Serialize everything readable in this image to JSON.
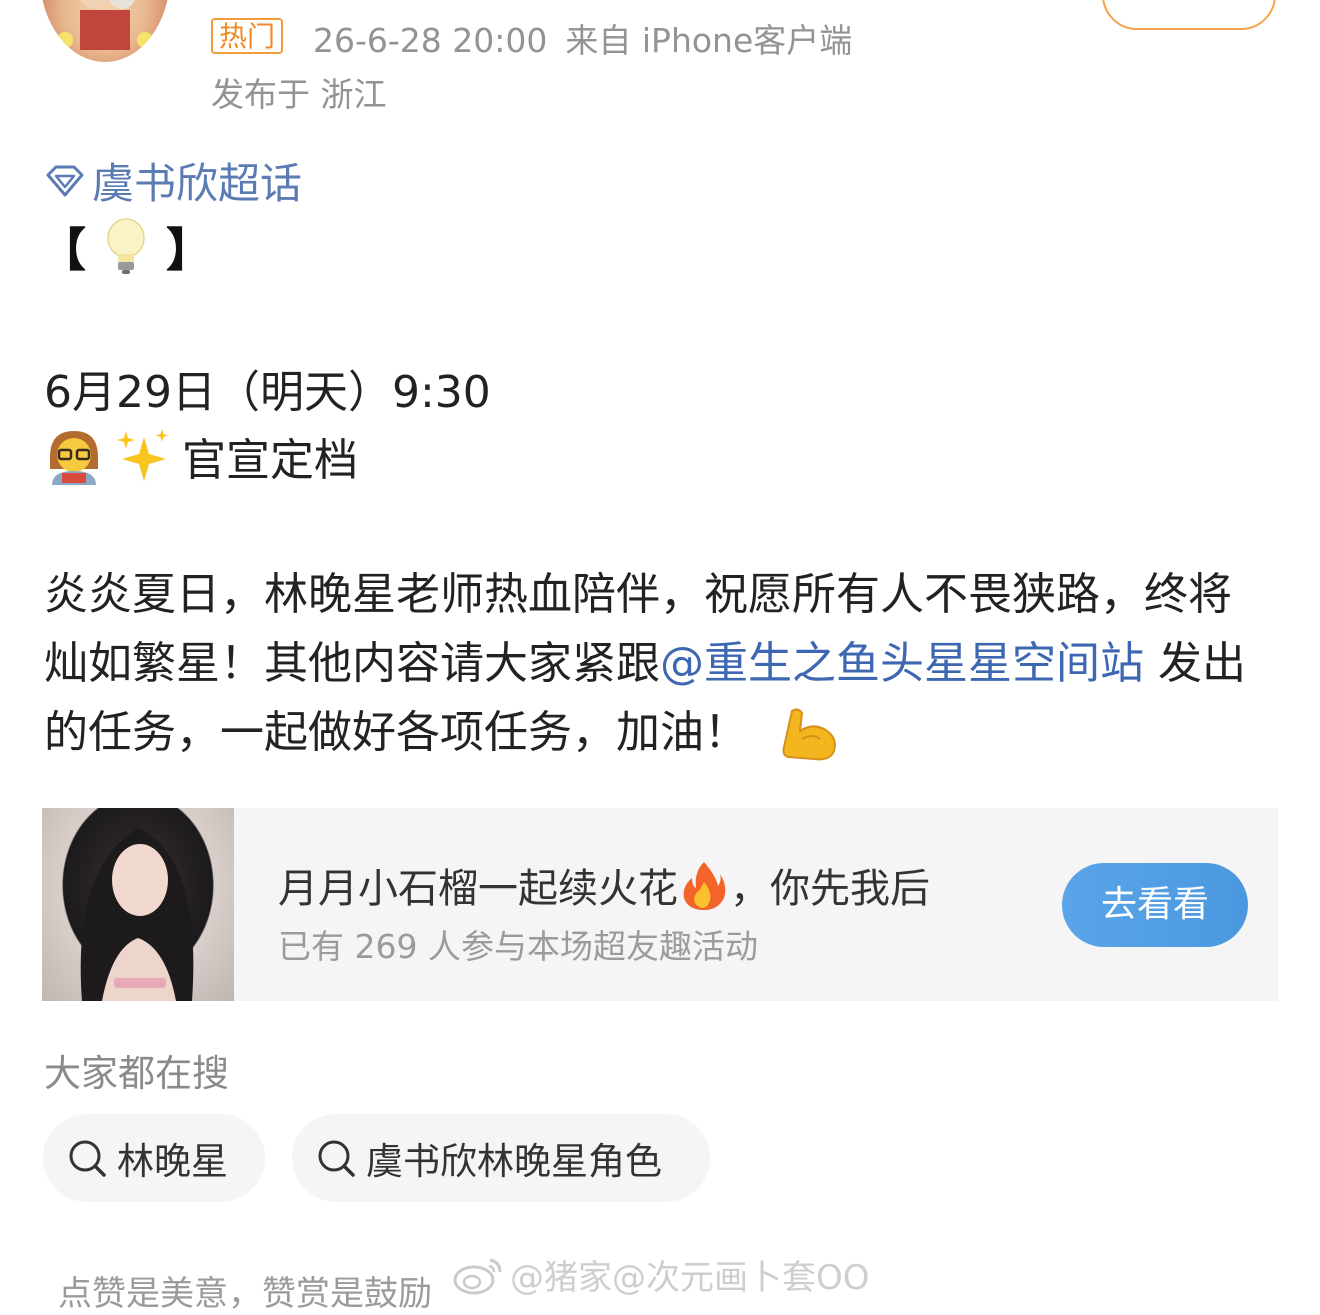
{
  "header": {
    "hot_badge": "热门",
    "timestamp": "26-6-28 20:00",
    "source": "来自 iPhone客户端",
    "location": "发布于 浙江"
  },
  "post": {
    "topic": "虞书欣超话",
    "bracket_open": "【",
    "bracket_close": "】",
    "date_line": "6月29日（明天）9:30",
    "official_line": "官宣定档",
    "para_text_1": "炎炎夏日，林晚星老师热血陪伴，祝愿所有人不畏狭路，终将灿如繁星！其他内容请大家紧跟",
    "mention": "@重生之鱼头星星空间站",
    "para_text_2": " 发出的任务，一起做好各项任务，加油！"
  },
  "activity_card": {
    "title_part1": "月月小石榴一起续火花",
    "title_part2": "，你先我后",
    "subtitle": "已有 269 人参与本场超友趣活动",
    "button": "去看看"
  },
  "searches": {
    "heading": "大家都在搜",
    "items": [
      "林晚星",
      "虞书欣林晚星角色"
    ]
  },
  "footer": {
    "text": "点赞是美意，赞赏是鼓励",
    "watermark": "@猪家@次元画卜套OO"
  },
  "colors": {
    "link_blue": "#3d67b1",
    "topic_blue": "#5b7bb3",
    "hot_orange": "#f08a24",
    "button_blue": "#4b98e0",
    "meta_grey": "#939393"
  },
  "icons": [
    "diamond-icon",
    "lightbulb-icon",
    "teacher-icon",
    "sparkles-icon",
    "flexed-bicep-icon",
    "fire-icon",
    "search-icon",
    "weibo-logo-icon"
  ]
}
